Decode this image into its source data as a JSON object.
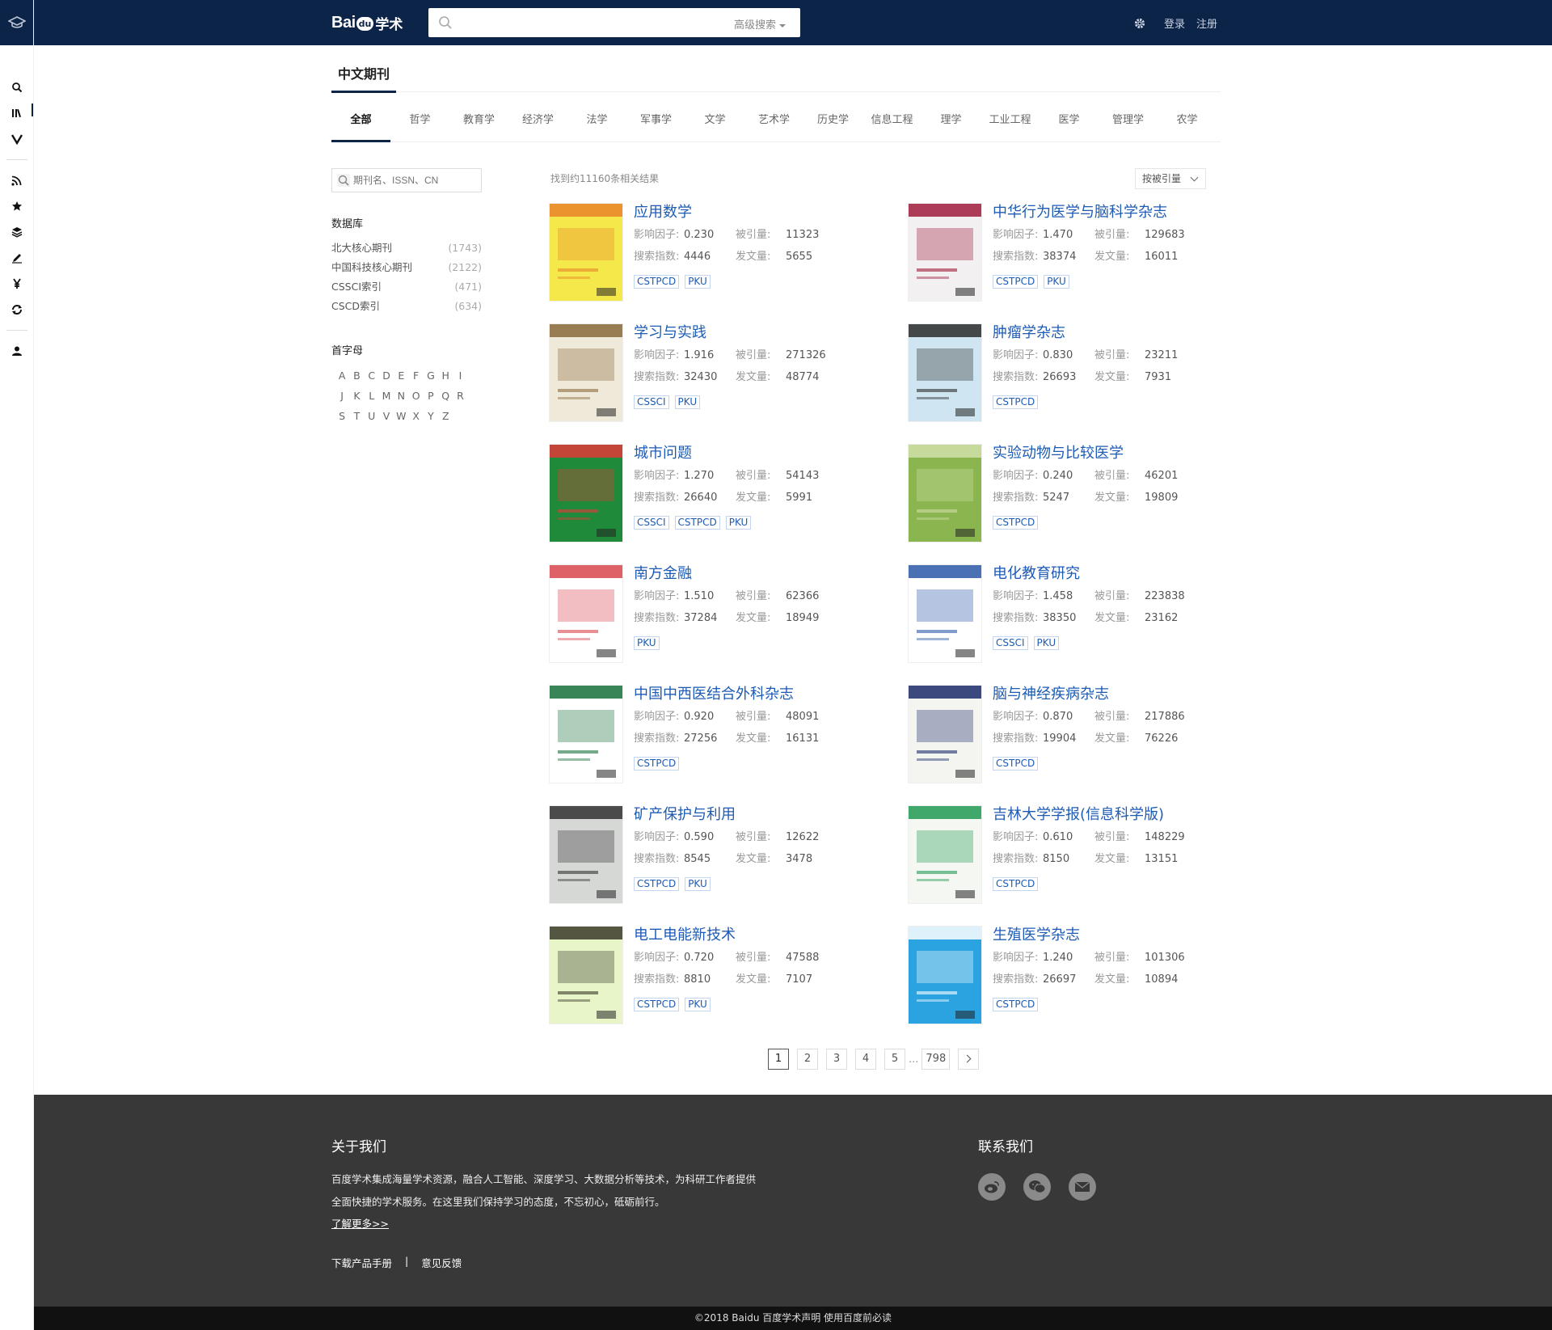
{
  "header": {
    "logo_text": "Bai",
    "logo_paw": "du",
    "logo_suffix": "学术",
    "search_placeholder": "",
    "advanced_search": "高级搜索",
    "login": "登录",
    "register": "注册"
  },
  "rail": {
    "icons": [
      "search-icon",
      "library-icon",
      "v-icon",
      "rss-icon",
      "star-icon",
      "layers-icon",
      "pen-icon",
      "yen-icon",
      "refresh-icon",
      "user-icon"
    ]
  },
  "page": {
    "title": "中文期刊",
    "categories": [
      "全部",
      "哲学",
      "教育学",
      "经济学",
      "法学",
      "军事学",
      "文学",
      "艺术学",
      "历史学",
      "信息工程",
      "理学",
      "工业工程",
      "医学",
      "管理学",
      "农学"
    ],
    "active_category": "全部"
  },
  "sidebar": {
    "search_placeholder": "期刊名、ISSN、CN",
    "db_heading": "数据库",
    "databases": [
      {
        "name": "北大核心期刊",
        "count": "(1743)"
      },
      {
        "name": "中国科技核心期刊",
        "count": "(2122)"
      },
      {
        "name": "CSSCI索引",
        "count": "(471)"
      },
      {
        "name": "CSCD索引",
        "count": "(634)"
      }
    ],
    "alpha_heading": "首字母",
    "letters": [
      "A",
      "B",
      "C",
      "D",
      "E",
      "F",
      "G",
      "H",
      "I",
      "J",
      "K",
      "L",
      "M",
      "N",
      "O",
      "P",
      "Q",
      "R",
      "S",
      "T",
      "U",
      "V",
      "W",
      "X",
      "Y",
      "Z"
    ]
  },
  "results": {
    "count_text": "找到约11160条相关结果",
    "sort_label": "按被引量",
    "labels": {
      "impact": "影响因子:",
      "cited": "被引量:",
      "search": "搜索指数:",
      "published": "发文量:"
    },
    "journals": [
      {
        "name": "应用数学",
        "impact": "0.230",
        "cited": "11323",
        "search": "4446",
        "published": "5655",
        "tags": [
          "CSTPCD",
          "PKU"
        ],
        "cover_color": "#f5e84a",
        "cover_accent": "#e8842a"
      },
      {
        "name": "中华行为医学与脑科学杂志",
        "impact": "1.470",
        "cited": "129683",
        "search": "38374",
        "published": "16011",
        "tags": [
          "CSTPCD",
          "PKU"
        ],
        "cover_color": "#f2f0f0",
        "cover_accent": "#a11c3d"
      },
      {
        "name": "学习与实践",
        "impact": "1.916",
        "cited": "271326",
        "search": "32430",
        "published": "48774",
        "tags": [
          "CSSCI",
          "PKU"
        ],
        "cover_color": "#efe9da",
        "cover_accent": "#8a6a3a"
      },
      {
        "name": "肿瘤学杂志",
        "impact": "0.830",
        "cited": "23211",
        "search": "26693",
        "published": "7931",
        "tags": [
          "CSTPCD"
        ],
        "cover_color": "#cfe6f2",
        "cover_accent": "#2c2c2c"
      },
      {
        "name": "城市问题",
        "impact": "1.270",
        "cited": "54143",
        "search": "26640",
        "published": "5991",
        "tags": [
          "CSSCI",
          "CSTPCD",
          "PKU"
        ],
        "cover_color": "#1f8a3a",
        "cover_accent": "#e23a3a"
      },
      {
        "name": "实验动物与比较医学",
        "impact": "0.240",
        "cited": "46201",
        "search": "5247",
        "published": "19809",
        "tags": [
          "CSTPCD"
        ],
        "cover_color": "#8ab54f",
        "cover_accent": "#cfe0a8"
      },
      {
        "name": "南方金融",
        "impact": "1.510",
        "cited": "62366",
        "search": "37284",
        "published": "18949",
        "tags": [
          "PKU"
        ],
        "cover_color": "#ffffff",
        "cover_accent": "#d9454d"
      },
      {
        "name": "电化教育研究",
        "impact": "1.458",
        "cited": "223838",
        "search": "38350",
        "published": "23162",
        "tags": [
          "CSSCI",
          "PKU"
        ],
        "cover_color": "#ffffff",
        "cover_accent": "#2b58a8"
      },
      {
        "name": "中国中西医结合外科杂志",
        "impact": "0.920",
        "cited": "48091",
        "search": "27256",
        "published": "16131",
        "tags": [
          "CSTPCD"
        ],
        "cover_color": "#ffffff",
        "cover_accent": "#17703a"
      },
      {
        "name": "脑与神经疾病杂志",
        "impact": "0.870",
        "cited": "217886",
        "search": "19904",
        "published": "76226",
        "tags": [
          "CSTPCD"
        ],
        "cover_color": "#f4f4f0",
        "cover_accent": "#1a2a6b"
      },
      {
        "name": "矿产保护与利用",
        "impact": "0.590",
        "cited": "12622",
        "search": "8545",
        "published": "3478",
        "tags": [
          "CSTPCD",
          "PKU"
        ],
        "cover_color": "#d6d8d6",
        "cover_accent": "#333333"
      },
      {
        "name": "吉林大学学报(信息科学版)",
        "impact": "0.610",
        "cited": "148229",
        "search": "8150",
        "published": "13151",
        "tags": [
          "CSTPCD"
        ],
        "cover_color": "#f4f7f2",
        "cover_accent": "#1f9a52"
      },
      {
        "name": "电工电能新技术",
        "impact": "0.720",
        "cited": "47588",
        "search": "8810",
        "published": "7107",
        "tags": [
          "CSTPCD",
          "PKU"
        ],
        "cover_color": "#e7f5c8",
        "cover_accent": "#3a3a2a"
      },
      {
        "name": "生殖医学杂志",
        "impact": "1.240",
        "cited": "101306",
        "search": "26697",
        "published": "10894",
        "tags": [
          "CSTPCD"
        ],
        "cover_color": "#2aa3e0",
        "cover_accent": "#ffffff"
      }
    ]
  },
  "pagination": {
    "pages": [
      "1",
      "2",
      "3",
      "4",
      "5"
    ],
    "dots": "...",
    "last": "798",
    "current": "1"
  },
  "footer": {
    "about_title": "关于我们",
    "about_line1": "百度学术集成海量学术资源，融合人工智能、深度学习、大数据分析等技术，为科研工作者提供",
    "about_line2": "全面快捷的学术服务。在这里我们保持学习的态度，不忘初心，砥砺前行。",
    "more": "了解更多>>",
    "manual": "下载产品手册",
    "divider": "|",
    "feedback": "意见反馈",
    "contact_title": "联系我们",
    "copyright": "©2018 Baidu 百度学术声明 使用百度前必读"
  }
}
